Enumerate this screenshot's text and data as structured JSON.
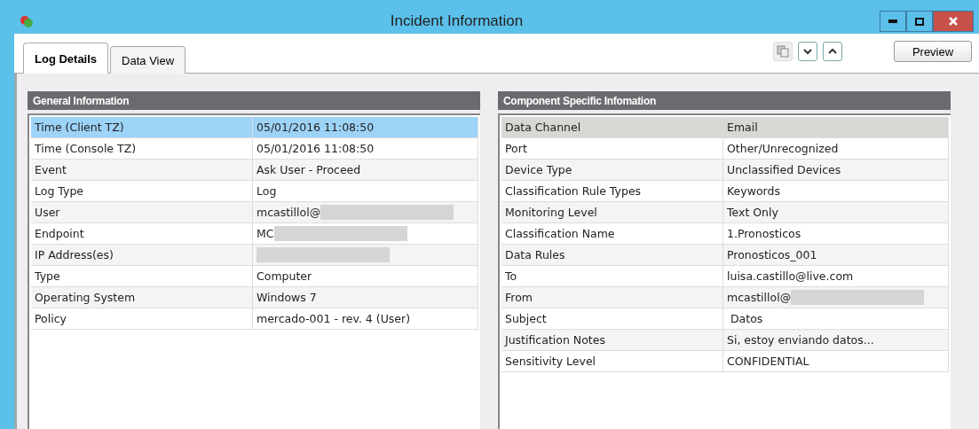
{
  "window": {
    "title": "Incident Information"
  },
  "tabs": [
    {
      "label": "Log Details",
      "selected": true
    },
    {
      "label": "Data View",
      "selected": false
    }
  ],
  "toolbar": {
    "buttons": [
      {
        "kind": "copy"
      },
      {
        "kind": "down"
      },
      {
        "kind": "up"
      }
    ],
    "preview": "Preview"
  },
  "panels": [
    {
      "title": "General Information",
      "focused": true,
      "rows": [
        {
          "label": "Time (Client TZ)",
          "value": "05/01/2016 11:08:50",
          "selected": true,
          "redacted": false
        },
        {
          "label": "Time (Console TZ)",
          "value": "05/01/2016 11:08:50",
          "selected": false,
          "redacted": false
        },
        {
          "label": "Event",
          "value": "Ask User - Proceed",
          "selected": false,
          "redacted": false
        },
        {
          "label": "Log Type",
          "value": "Log",
          "selected": false,
          "redacted": false
        },
        {
          "label": "User",
          "value": "mcastillol@",
          "selected": false,
          "redacted": true
        },
        {
          "label": "Endpoint",
          "value": "MC",
          "selected": false,
          "redacted": true
        },
        {
          "label": "IP Address(es)",
          "selected": false,
          "redacted": true
        },
        {
          "label": "Type",
          "value": "Computer",
          "selected": false,
          "redacted": false
        },
        {
          "label": "Operating System",
          "value": "Windows 7",
          "selected": false,
          "redacted": false
        },
        {
          "label": "Policy",
          "value": "mercado-001 - rev. 4 (User)",
          "selected": false,
          "redacted": false
        }
      ]
    },
    {
      "title": "Component Specific Infomation",
      "focused": false,
      "rows": [
        {
          "label": "Data Channel",
          "value": "Email",
          "selected": true,
          "redacted": false
        },
        {
          "label": "Port",
          "value": "Other/Unrecognized",
          "selected": false,
          "redacted": false
        },
        {
          "label": "Device Type",
          "value": "Unclassified Devices",
          "selected": false,
          "redacted": false
        },
        {
          "label": "Classification Rule Types",
          "value": "Keywords",
          "selected": false,
          "redacted": false
        },
        {
          "label": "Monitoring Level",
          "value": "Text Only",
          "selected": false,
          "redacted": false
        },
        {
          "label": "Classification Name",
          "value": "1.Pronosticos",
          "selected": false,
          "redacted": false
        },
        {
          "label": "Data Rules",
          "value": "Pronosticos_001",
          "selected": false,
          "redacted": false
        },
        {
          "label": "To",
          "value": "luisa.castillo@live.com",
          "selected": false,
          "redacted": false
        },
        {
          "label": "From",
          "value": "mcastillol@",
          "selected": false,
          "redacted": true
        },
        {
          "label": "Subject",
          "value": " Datos",
          "selected": false,
          "redacted": false
        },
        {
          "label": "Justification Notes",
          "value": "Si, estoy enviando datos...",
          "selected": false,
          "redacted": false
        },
        {
          "label": "Sensitivity Level",
          "value": "CONFIDENTIAL",
          "selected": false,
          "redacted": false
        }
      ]
    }
  ]
}
